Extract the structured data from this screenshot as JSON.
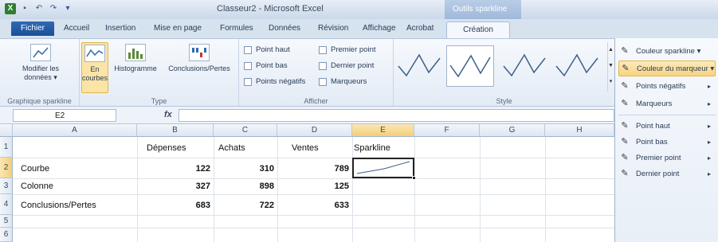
{
  "window": {
    "title": "Classeur2 - Microsoft Excel",
    "context_group": "Outils sparkline"
  },
  "tabs": [
    "Fichier",
    "Accueil",
    "Insertion",
    "Mise en page",
    "Formules",
    "Données",
    "Révision",
    "Affichage",
    "Acrobat",
    "Création"
  ],
  "ribbon": {
    "groups": {
      "sparkline": {
        "label": "Graphique sparkline",
        "edit_data": "Modifier les données ▾"
      },
      "type": {
        "label": "Type",
        "line": "En courbes",
        "column": "Histogramme",
        "winloss": "Conclusions/Pertes"
      },
      "show": {
        "label": "Afficher",
        "high": "Point haut",
        "low": "Point bas",
        "negative": "Points négatifs",
        "first": "Premier point",
        "last": "Dernier point",
        "markers": "Marqueurs"
      },
      "style": {
        "label": "Style"
      }
    }
  },
  "formula_bar": {
    "name_box": "E2",
    "fx": "fx",
    "value": ""
  },
  "grid": {
    "columns": [
      "A",
      "B",
      "C",
      "D",
      "E",
      "F",
      "G",
      "H"
    ],
    "rows": [
      "1",
      "2",
      "3",
      "4",
      "5",
      "6"
    ],
    "header_row": {
      "b": "Dépenses",
      "c": "Achats",
      "d": "Ventes",
      "e": "Sparkline"
    },
    "data": [
      {
        "label": "Courbe",
        "b": "122",
        "c": "310",
        "d": "789"
      },
      {
        "label": "Colonne",
        "b": "327",
        "c": "898",
        "d": "125"
      },
      {
        "label": "Conclusions/Pertes",
        "b": "683",
        "c": "722",
        "d": "633"
      }
    ]
  },
  "menu": {
    "items": [
      {
        "label": "Couleur sparkline ▾",
        "icon": "pen-icon"
      },
      {
        "label": "Couleur du marqueur ▾",
        "icon": "pen-icon"
      },
      {
        "label": "Points négatifs",
        "icon": "pen-icon"
      },
      {
        "label": "Marqueurs",
        "icon": "pen-icon"
      },
      {
        "label": "Point haut",
        "icon": "pen-icon"
      },
      {
        "label": "Point bas",
        "icon": "pen-icon"
      },
      {
        "label": "Premier point",
        "icon": "pen-icon"
      },
      {
        "label": "Dernier point",
        "icon": "pen-icon"
      }
    ]
  },
  "colors": {
    "accent": "#2e6ab4",
    "selection": "#f7d480"
  }
}
